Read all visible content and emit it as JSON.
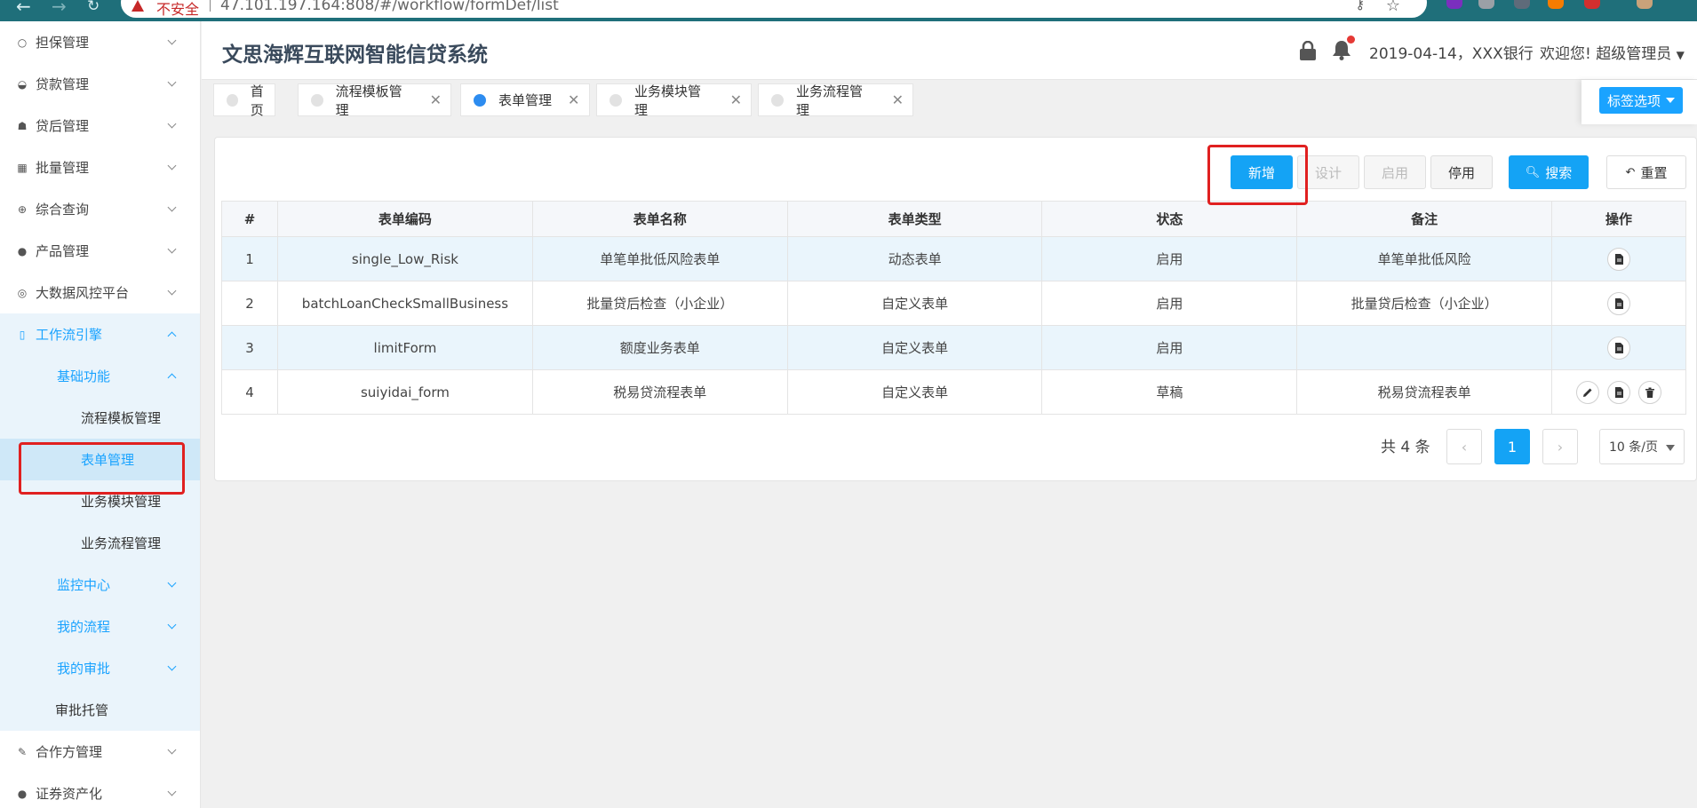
{
  "browser": {
    "insecure_label": "不安全",
    "url": "47.101.197.164:808/#/workflow/formDef/list"
  },
  "header": {
    "title": "文思海辉互联网智能信贷系统",
    "date_bank": "2019-04-14，XXX银行",
    "welcome": "欢迎您! 超级管理员"
  },
  "sidebar": {
    "items": [
      {
        "label": "担保管理",
        "icon": "circle-outline-icon"
      },
      {
        "label": "贷款管理",
        "icon": "gauge-icon"
      },
      {
        "label": "贷后管理",
        "icon": "car-icon"
      },
      {
        "label": "批量管理",
        "icon": "grid-icon"
      },
      {
        "label": "综合查询",
        "icon": "globe-icon"
      },
      {
        "label": "产品管理",
        "icon": "bullet-icon"
      },
      {
        "label": "大数据风控平台",
        "icon": "fingerprint-icon"
      },
      {
        "label": "工作流引擎",
        "icon": "phone-icon"
      }
    ],
    "workflow_sub": {
      "basic": "基础功能",
      "leaves": [
        "流程模板管理",
        "表单管理",
        "业务模块管理",
        "业务流程管理"
      ],
      "monitor": "监控中心",
      "my_process": "我的流程",
      "my_approval": "我的审批",
      "approval_trust": "审批托管"
    },
    "after": [
      {
        "label": "合作方管理",
        "icon": "brush-icon"
      },
      {
        "label": "证券资产化",
        "icon": "bullet-icon"
      }
    ]
  },
  "tabs": [
    {
      "label": "首页",
      "closable": false,
      "active": false
    },
    {
      "label": "流程模板管理",
      "closable": true,
      "active": false
    },
    {
      "label": "表单管理",
      "closable": true,
      "active": true
    },
    {
      "label": "业务模块管理",
      "closable": true,
      "active": false
    },
    {
      "label": "业务流程管理",
      "closable": true,
      "active": false
    }
  ],
  "tag_options": "标签选项",
  "toolbar": {
    "add": "新增",
    "design": "设计",
    "enable": "启用",
    "disable": "停用",
    "search": "搜索",
    "reset": "重置"
  },
  "table": {
    "headers": [
      "#",
      "表单编码",
      "表单名称",
      "表单类型",
      "状态",
      "备注",
      "操作"
    ],
    "rows": [
      {
        "no": "1",
        "code": "single_Low_Risk",
        "name": "单笔单批低风险表单",
        "type": "动态表单",
        "status": "启用",
        "remark": "单笔单批低风险",
        "ops": [
          "doc"
        ]
      },
      {
        "no": "2",
        "code": "batchLoanCheckSmallBusiness",
        "name": "批量贷后检查（小企业）",
        "type": "自定义表单",
        "status": "启用",
        "remark": "批量贷后检查（小企业）",
        "ops": [
          "doc"
        ]
      },
      {
        "no": "3",
        "code": "limitForm",
        "name": "额度业务表单",
        "type": "自定义表单",
        "status": "启用",
        "remark": "",
        "ops": [
          "doc"
        ]
      },
      {
        "no": "4",
        "code": "suiyidai_form",
        "name": "税易贷流程表单",
        "type": "自定义表单",
        "status": "草稿",
        "remark": "税易贷流程表单",
        "ops": [
          "edit",
          "doc",
          "delete"
        ]
      }
    ]
  },
  "pager": {
    "total": "共 4 条",
    "current": "1",
    "page_size": "10 条/页"
  },
  "colors": {
    "accent": "#14a3f5",
    "highlight_red": "#e02020",
    "row_alt": "#eaf5fc"
  }
}
